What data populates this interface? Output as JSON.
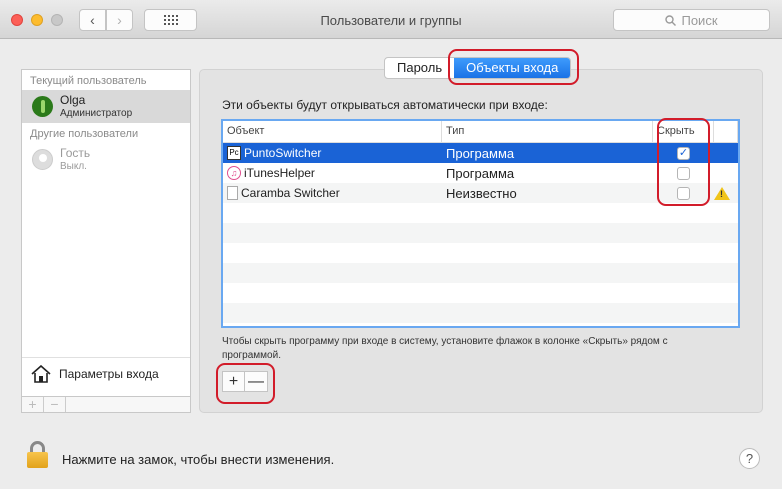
{
  "window": {
    "title": "Пользователи и группы"
  },
  "toolbar": {
    "back_glyph": "‹",
    "forward_glyph": "›",
    "search_placeholder": "Поиск"
  },
  "sidebar": {
    "current_section": "Текущий пользователь",
    "current_user": {
      "name": "Olga",
      "role": "Администратор"
    },
    "other_section": "Другие пользователи",
    "other_user": {
      "name": "Гость",
      "role": "Выкл."
    },
    "login_options": "Параметры входа",
    "add": "+",
    "remove": "−"
  },
  "tabs": {
    "password": "Пароль",
    "login_items": "Объекты входа"
  },
  "description": "Эти объекты будут открываться автоматически при входе:",
  "table": {
    "headers": {
      "item": "Объект",
      "type": "Тип",
      "hide": "Скрыть"
    },
    "rows": [
      {
        "name": "PuntoSwitcher",
        "type": "Программа",
        "icon_text": "Pс",
        "hidden": true
      },
      {
        "name": "iTunesHelper",
        "type": "Программа",
        "icon_text": "♫",
        "hidden": false
      },
      {
        "name": "Caramba Switcher",
        "type": "Неизвестно",
        "icon_text": "",
        "hidden": false,
        "warning": "!"
      }
    ]
  },
  "hint": "Чтобы скрыть программу при входе в систему, установите флажок в колонке «Скрыть» рядом с программой.",
  "buttons": {
    "add": "+",
    "remove": "—"
  },
  "footer": {
    "lock_text": "Нажмите на замок, чтобы внести изменения.",
    "help": "?"
  },
  "check_glyph": "✓",
  "colors": {
    "accent": "#1a63d6",
    "callout": "#d21c2a"
  }
}
